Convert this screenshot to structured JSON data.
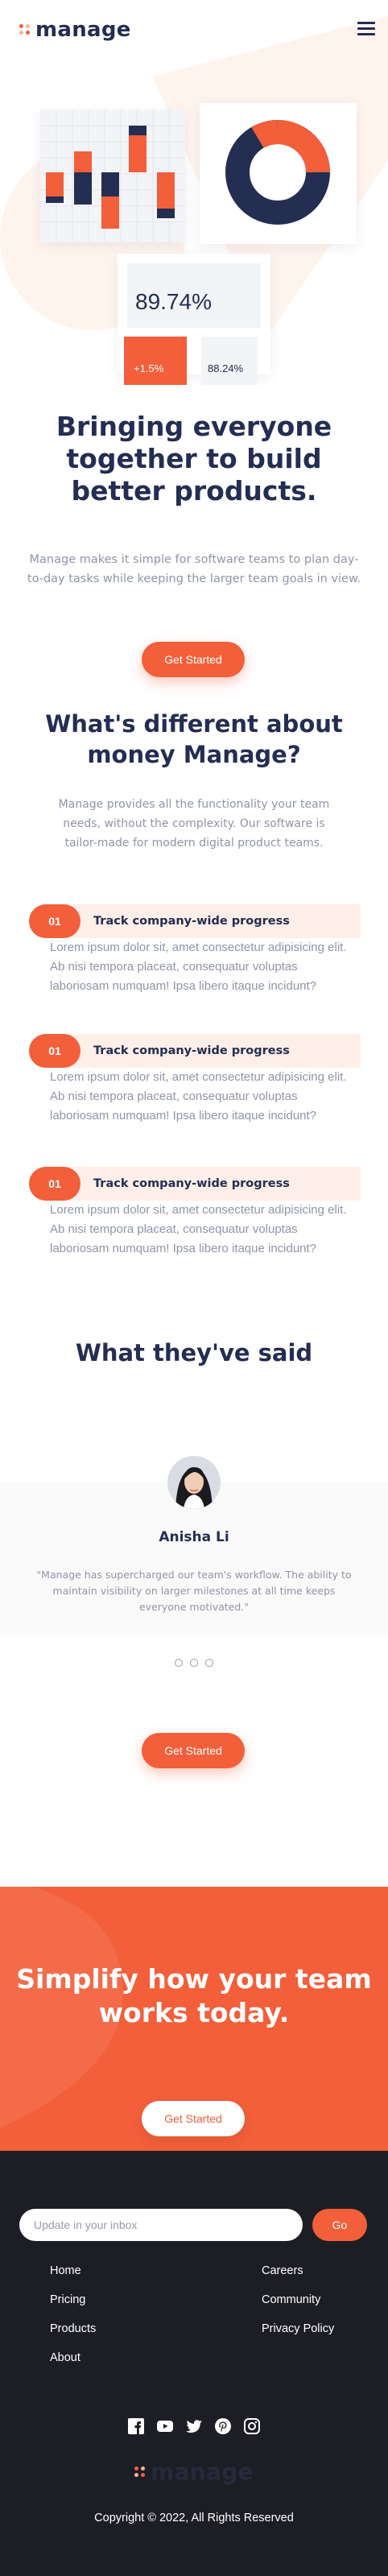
{
  "brand": {
    "name": "manage",
    "colors": {
      "primary": "#f25f3a",
      "dark_blue": "#242d52",
      "pale_orange": "#ffefe9",
      "gray": "#9095a7",
      "footer_bg": "#1d1e25"
    }
  },
  "header": {
    "menu_icon": "hamburger-icon"
  },
  "hero": {
    "stat_value": "89.74%",
    "stat_change": "+1.5%",
    "stat_secondary": "88.24%",
    "title": "Bringing everyone together to build better products.",
    "description": "Manage makes it simple for software teams to plan day-to-day tasks while keeping the larger team goals in view.",
    "cta_label": "Get Started"
  },
  "difference": {
    "title": "What's different about money Manage?",
    "description": "Manage provides all the functionality your team needs, without the complexity. Our software is tailor-made for modern digital product teams.",
    "features": [
      {
        "number": "01",
        "title": "Track company-wide progress",
        "text": "Lorem ipsum dolor sit, amet consectetur adipisicing elit. Ab nisi tempora placeat, consequatur voluptas laboriosam numquam! Ipsa libero itaque incidunt?"
      },
      {
        "number": "01",
        "title": "Track company-wide progress",
        "text": "Lorem ipsum dolor sit, amet consectetur adipisicing elit. Ab nisi tempora placeat, consequatur voluptas laboriosam numquam! Ipsa libero itaque incidunt?"
      },
      {
        "number": "01",
        "title": "Track company-wide progress",
        "text": "Lorem ipsum dolor sit, amet consectetur adipisicing elit. Ab nisi tempora placeat, consequatur voluptas laboriosam numquam! Ipsa libero itaque incidunt?"
      }
    ]
  },
  "testimonials": {
    "title": "What they've said",
    "name": "Anisha Li",
    "quote": "\"Manage has supercharged our team's workflow. The ability to maintain visibility on larger milestones at all time keeps everyone motivated.\"",
    "cta_label": "Get Started"
  },
  "cta_band": {
    "title": "Simplify how your team works today.",
    "button_label": "Get Started"
  },
  "footer": {
    "subscribe_placeholder": "Update in your inbox",
    "go_label": "Go",
    "links_left": [
      "Home",
      "Pricing",
      "Products",
      "About"
    ],
    "links_right": [
      "Careers",
      "Community",
      "Privacy Policy"
    ],
    "socials": [
      "facebook-icon",
      "youtube-icon",
      "twitter-icon",
      "pinterest-icon",
      "instagram-icon"
    ],
    "logo_text": "manage",
    "copyright": "Copyright © 2022, All Rights Reserved"
  }
}
